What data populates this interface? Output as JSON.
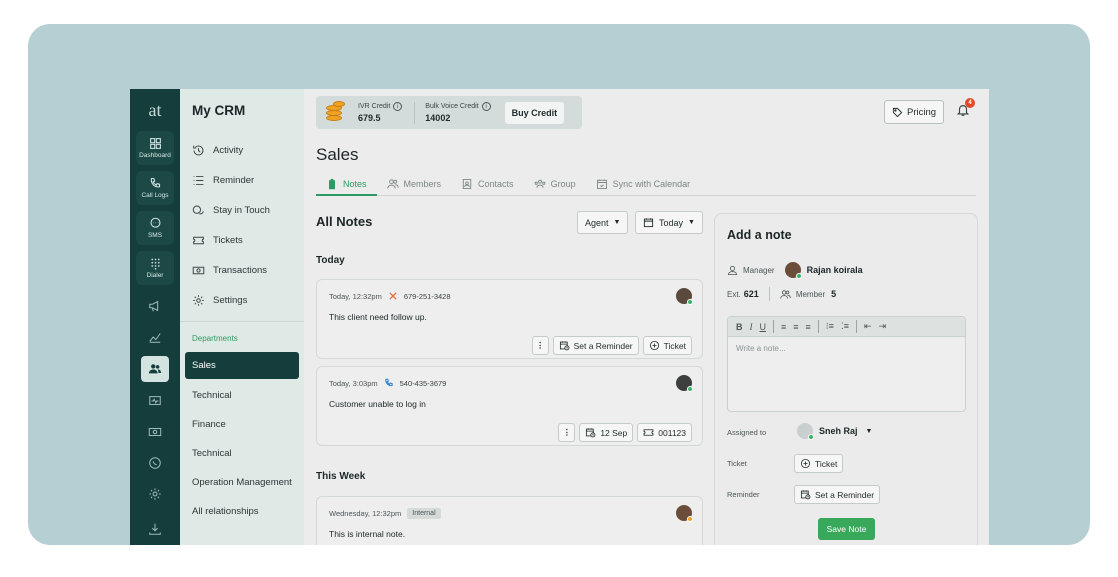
{
  "rail": {
    "logo": "at",
    "items": [
      {
        "label": "Dashboard",
        "icon": "grid-icon"
      },
      {
        "label": "Call Logs",
        "icon": "phone-icon"
      },
      {
        "label": "SMS",
        "icon": "sms-icon"
      },
      {
        "label": "Dialer",
        "icon": "dialpad-icon"
      }
    ],
    "icons": [
      "megaphone-icon",
      "analytics-icon",
      "contacts-icon",
      "monitor-icon",
      "money-icon",
      "whatsapp-icon",
      "settings-icon"
    ],
    "bottom_icon": "download-icon"
  },
  "sidebar": {
    "title": "My CRM",
    "items": [
      {
        "label": "Activity",
        "icon": "history-icon"
      },
      {
        "label": "Reminder",
        "icon": "list-icon"
      },
      {
        "label": "Stay in Touch",
        "icon": "chat-icon"
      },
      {
        "label": "Tickets",
        "icon": "ticket-icon"
      },
      {
        "label": "Transactions",
        "icon": "cash-icon"
      },
      {
        "label": "Settings",
        "icon": "gear-icon"
      }
    ],
    "departments_label": "Departments",
    "departments": [
      "Sales",
      "Technical",
      "Finance",
      "Technical",
      "Operation Management",
      "All relationships"
    ],
    "active_department": "Sales"
  },
  "header": {
    "ivr_label": "IVR Credit",
    "ivr_value": "679.5",
    "bulk_label": "Bulk Voice Credit",
    "bulk_value": "14002",
    "buy_label": "Buy Credit",
    "pricing_label": "Pricing",
    "notification_count": "4"
  },
  "page": {
    "title": "Sales",
    "tabs": [
      {
        "label": "Notes",
        "icon": "clipboard-icon",
        "active": true
      },
      {
        "label": "Members",
        "icon": "members-icon"
      },
      {
        "label": "Contacts",
        "icon": "contact-card-icon"
      },
      {
        "label": "Group",
        "icon": "group-icon"
      },
      {
        "label": "Sync with Calendar",
        "icon": "calendar-sync-icon"
      }
    ]
  },
  "notes": {
    "title": "All Notes",
    "filter_agent": "Agent",
    "filter_date": "Today",
    "groups": {
      "today": "Today",
      "week": "This Week"
    },
    "items": [
      {
        "time": "Today, 12:32pm",
        "phone": "679-251-3428",
        "call_type": "missed",
        "text": "This client need follow up.",
        "actions": {
          "reminder": "Set a Reminder",
          "ticket": "Ticket"
        }
      },
      {
        "time": "Today, 3:03pm",
        "phone": "540-435-3679",
        "call_type": "incoming",
        "text": "Customer unable to log in",
        "actions": {
          "date": "12 Sep",
          "ticket_no": "001123"
        }
      },
      {
        "time": "Wednesday, 12:32pm",
        "tag": "Internal",
        "text": "This is internal note."
      }
    ]
  },
  "add_note": {
    "title": "Add a note",
    "manager_label": "Manager",
    "manager_name": "Rajan koirala",
    "ext_label": "Ext.",
    "ext_value": "621",
    "member_label": "Member",
    "member_value": "5",
    "toolbar": [
      "B",
      "I",
      "U"
    ],
    "placeholder": "Write a note...",
    "assigned_label": "Assigned to",
    "assigned_name": "Sneh Raj",
    "ticket_label": "Ticket",
    "ticket_btn": "Ticket",
    "reminder_label": "Reminder",
    "reminder_btn": "Set a Reminder",
    "save_label": "Save Note"
  },
  "colors": {
    "accent": "#2d9a63",
    "rail": "#143d3b",
    "save": "#38a85a",
    "missed_call": "#e8703a",
    "incoming_call": "#2a7fd4"
  }
}
